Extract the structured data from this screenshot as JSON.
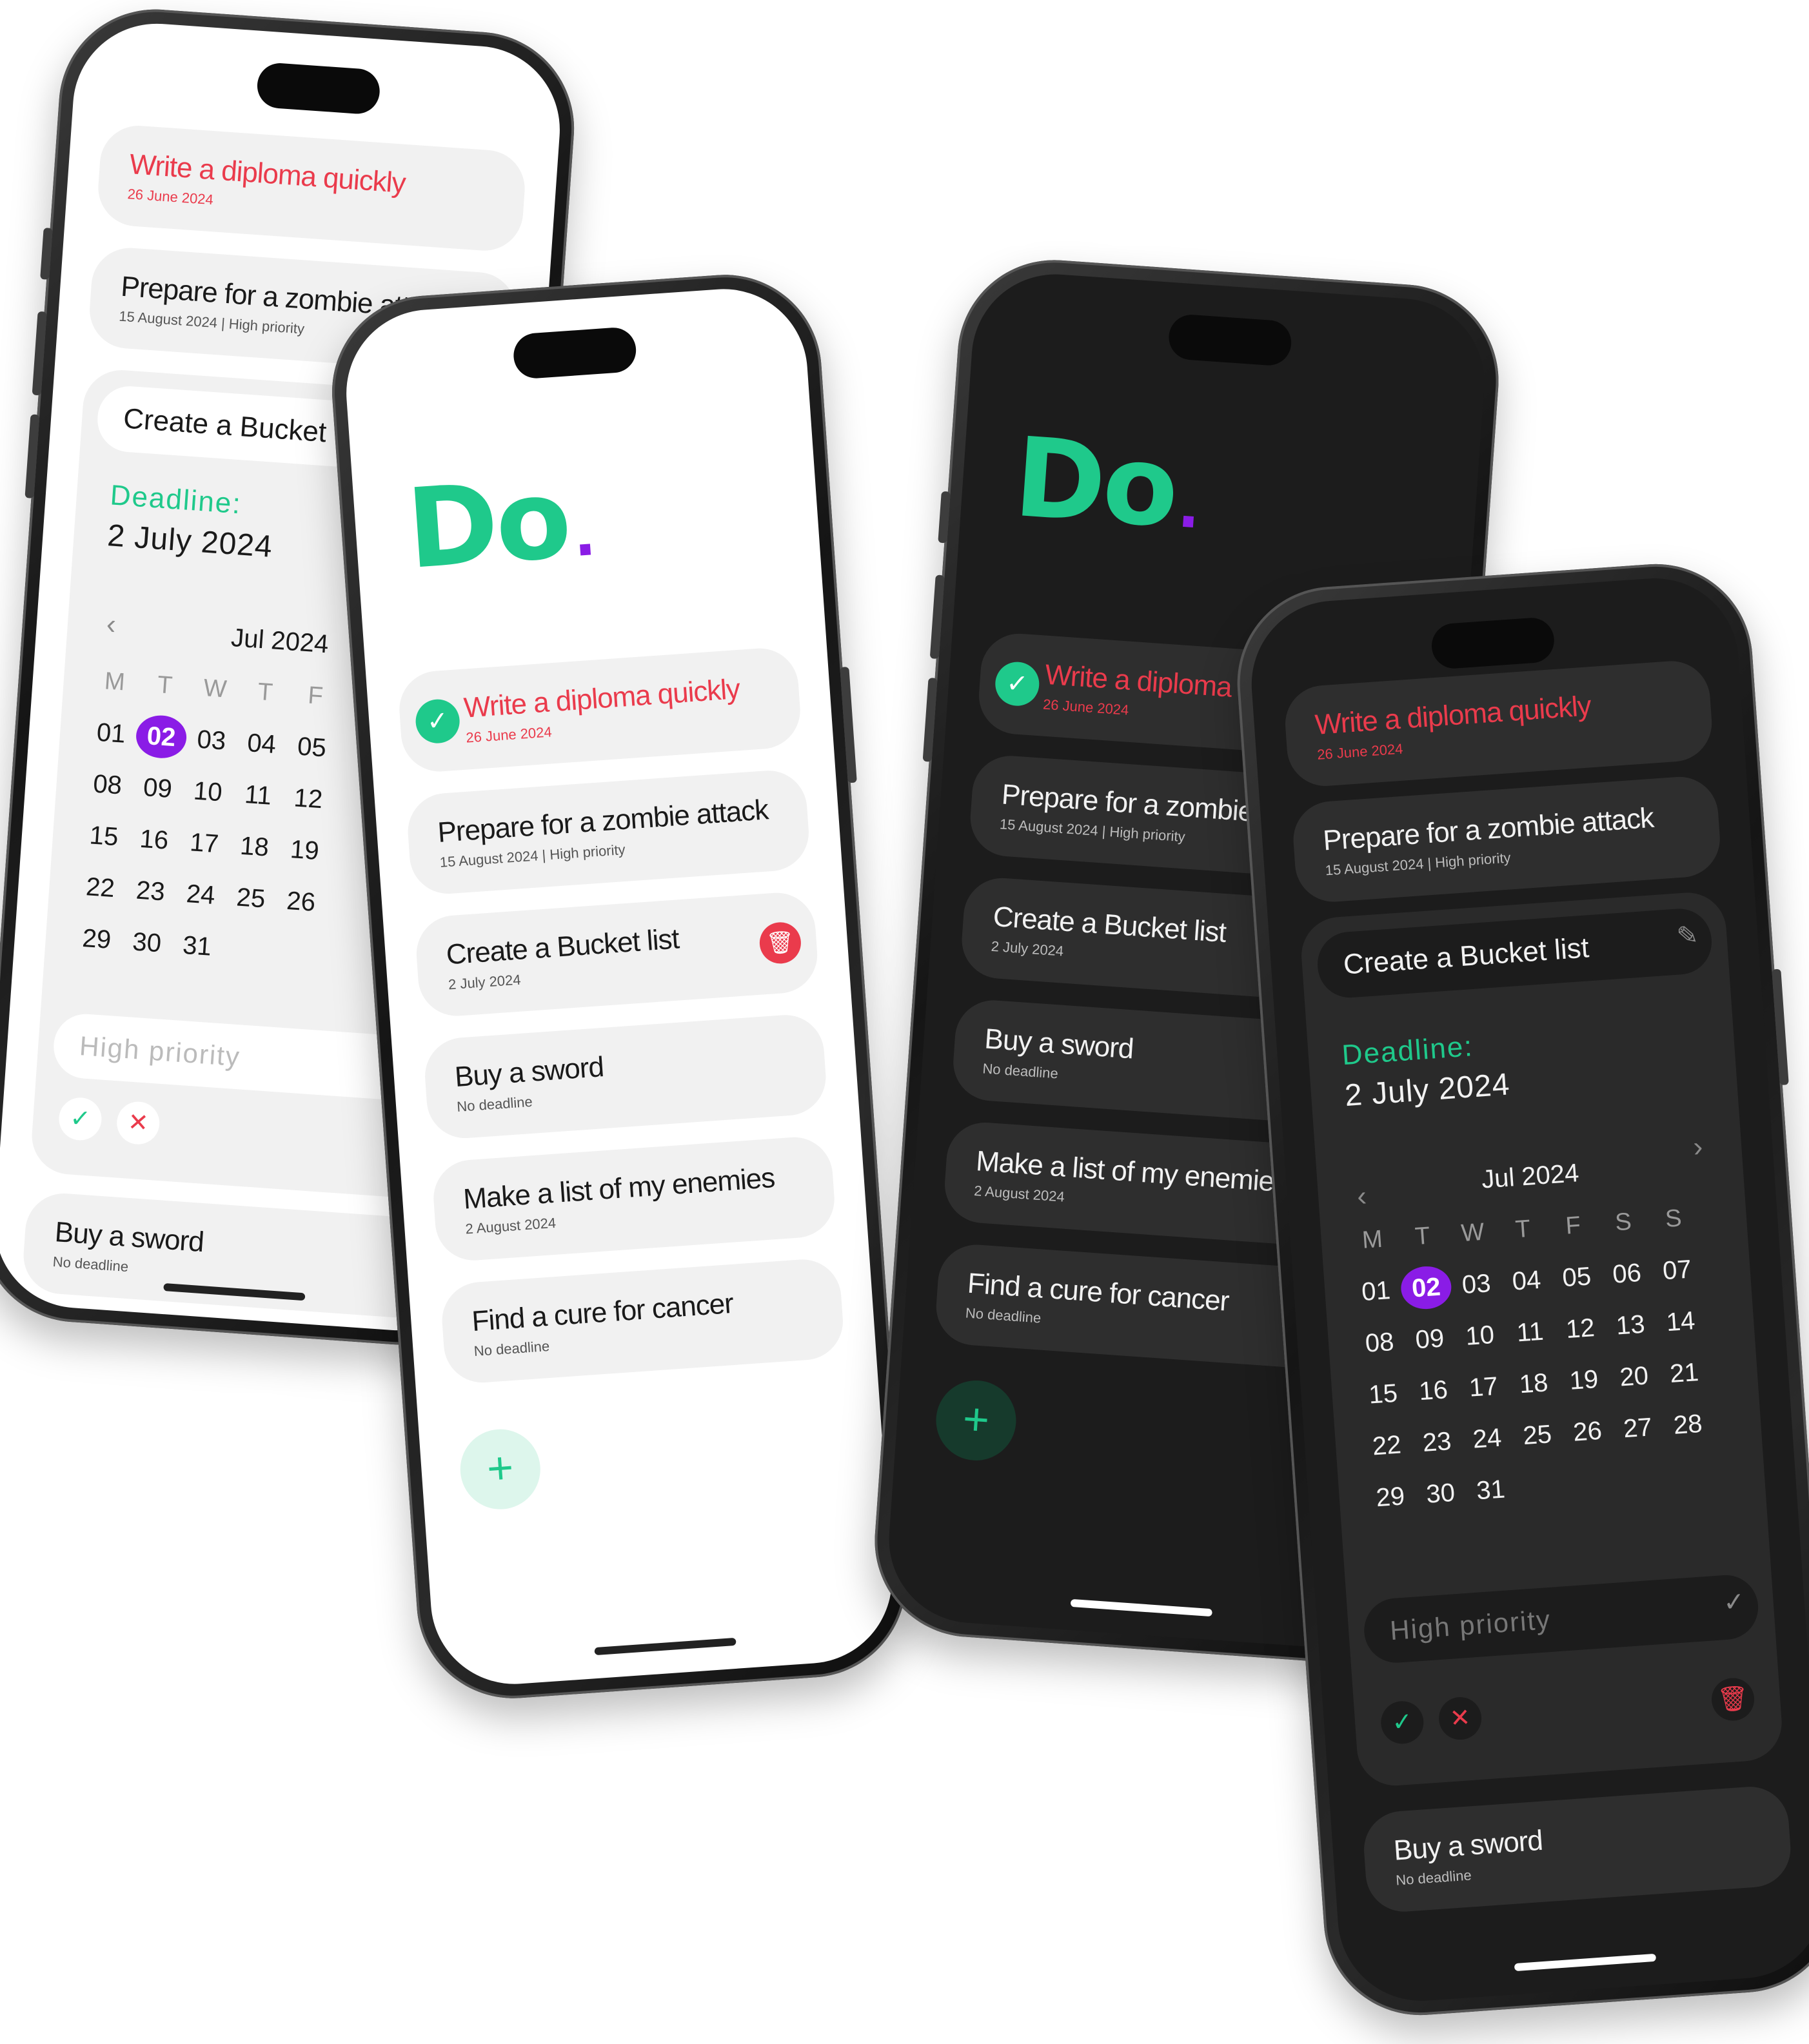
{
  "app": {
    "logo": "Do",
    "logo_dot": "."
  },
  "tasks": [
    {
      "title": "Write a diploma quickly",
      "sub": "26 June 2024"
    },
    {
      "title": "Prepare for a zombie attack",
      "sub": "15 August 2024 | High priority"
    },
    {
      "title": "Create a Bucket list",
      "sub": "2 July 2024"
    },
    {
      "title": "Buy a sword",
      "sub": "No deadline"
    },
    {
      "title": "Make a list of my enemies",
      "sub": "2 August 2024"
    },
    {
      "title": "Find a cure for cancer",
      "sub": "No deadline"
    }
  ],
  "editor": {
    "task_title": "Create a Bucket list",
    "deadline_label": "Deadline:",
    "deadline_value": "2 July 2024",
    "priority_placeholder": "High priority"
  },
  "calendar": {
    "month": "Jul 2024",
    "weekdays": [
      "M",
      "T",
      "W",
      "T",
      "F",
      "S",
      "S"
    ],
    "days": [
      "01",
      "02",
      "03",
      "04",
      "05",
      "06",
      "07",
      "08",
      "09",
      "10",
      "11",
      "12",
      "13",
      "14",
      "15",
      "16",
      "17",
      "18",
      "19",
      "20",
      "21",
      "22",
      "23",
      "24",
      "25",
      "26",
      "27",
      "28",
      "29",
      "30",
      "31"
    ],
    "selected": "02"
  },
  "icons": {
    "check": "check-icon",
    "close": "close-icon",
    "trash": "trash-icon",
    "plus": "plus-icon",
    "pencil": "pencil-icon",
    "prev": "chevron-left-icon",
    "next": "chevron-right-icon"
  },
  "colors": {
    "accent_green": "#1fc98b",
    "accent_purple": "#8a1ce6",
    "danger_red": "#ea3b4c"
  }
}
